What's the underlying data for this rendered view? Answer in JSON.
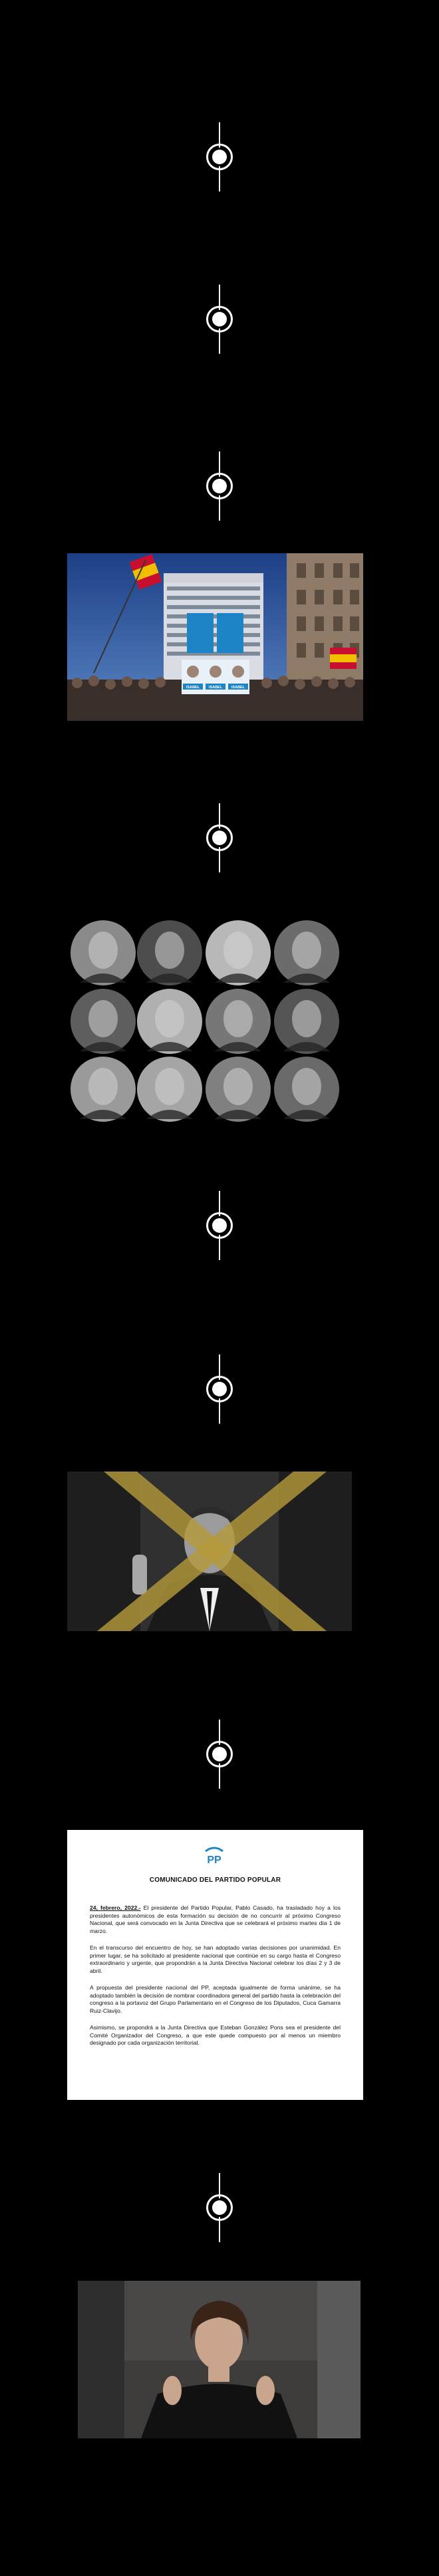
{
  "communique": {
    "title": "COMUNICADO DEL PARTIDO POPULAR",
    "date": "24, febrero, 2022.-",
    "paragraph1": "El presidente del Partido Popular, Pablo Casado, ha trasladado hoy a los presidentes autonómicos de esta formación su decisión de no concurrir al próximo Congreso Nacional, que será convocado en la Junta Directiva que se celebrará el próximo martes día 1 de marzo.",
    "paragraph2": "En el transcurso del encuentro de hoy, se han adoptado varias decisiones por unanimidad. En primer lugar, se ha solicitado al presidente nacional que continúe en su cargo hasta el Congreso extraordinario y urgente, que propondrán a la Junta Directiva Nacional celebrar los días 2 y 3 de abril.",
    "paragraph3": "A propuesta del presidente nacional del PP, aceptada igualmente de forma unánime, se ha adoptado también la decisión de nombrar coordinadora general del partido hasta la celebración del congreso a la portavoz del Grupo Parlamentario en el Congreso de los Diputados, Cuca Gamarra Ruiz-Clavijo.",
    "paragraph4": "Asimismo, se propondrá a la Junta Directiva que Esteban González Pons sea el presidente del Comité Organizador del Congreso, a que este quede compuesto por al menos un miembro designado por cada organización territorial.",
    "logo_text": "PP"
  },
  "banner_signs": [
    "ISABEL",
    "ISABEL",
    "ISABEL"
  ],
  "colors": {
    "background": "#000000",
    "pp_blue": "#1d84c6",
    "cross_yellow": "#b59a3a"
  }
}
